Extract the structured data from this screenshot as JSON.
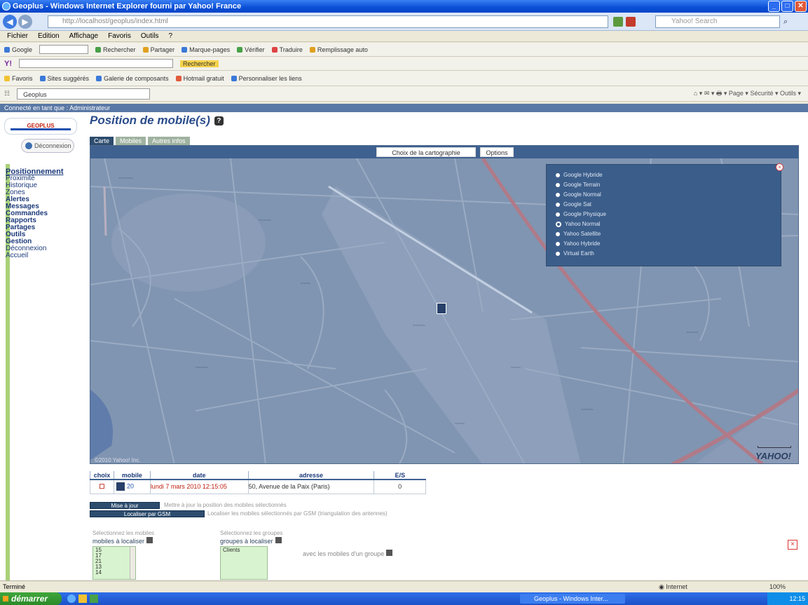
{
  "window": {
    "title": "Geoplus - Windows Internet Explorer fourni par Yahoo! France",
    "url": "http://localhost/geoplus/index.html",
    "search_placeholder": "Yahoo! Search",
    "menu": [
      "Fichier",
      "Edition",
      "Affichage",
      "Favoris",
      "Outils",
      "?"
    ]
  },
  "toolbars": {
    "google": [
      "Google",
      "Rechercher",
      "Partager",
      "Marque-pages",
      "Vérifier",
      "Traduire",
      "Remplissage auto"
    ],
    "links": [
      "Favoris",
      "Sites suggérés",
      "Galerie de composants",
      "Hotmail gratuit",
      "Personnaliser les liens"
    ],
    "tab_label": "Geoplus"
  },
  "page": {
    "user_bar": "Connecté en tant que : Administrateur",
    "logo": "GEOPLUS",
    "logout": "Déconnexion",
    "title": "Position de mobile(s)",
    "tabs": [
      "Carte",
      "Mobiles",
      "Autres infos"
    ],
    "nav": [
      {
        "label": "Positionnement",
        "active": true
      },
      {
        "label": "Proximité",
        "active": false
      },
      {
        "label": "Historique",
        "active": false
      },
      {
        "label": "Zones",
        "active": false
      },
      {
        "label": "Alertes",
        "active": false
      },
      {
        "label": "Messages",
        "active": false
      },
      {
        "label": "Commandes",
        "active": false
      },
      {
        "label": "Rapports",
        "active": false
      },
      {
        "label": "Partages",
        "active": false
      },
      {
        "label": "Outils",
        "active": false
      },
      {
        "label": "Gestion",
        "active": false
      },
      {
        "label": "Déconnexion",
        "active": false
      },
      {
        "label": "Accueil",
        "active": false
      }
    ]
  },
  "map": {
    "toolbar": {
      "cartography": "Choix de la cartographie",
      "options": "Options"
    },
    "layers": [
      {
        "label": "Google Hybride",
        "checked": false
      },
      {
        "label": "Google Terrain",
        "checked": false
      },
      {
        "label": "Google Normal",
        "checked": false
      },
      {
        "label": "Google Sat",
        "checked": false
      },
      {
        "label": "Google Physique",
        "checked": false
      },
      {
        "label": "Yahoo Normal",
        "checked": true
      },
      {
        "label": "Yahoo Satellite",
        "checked": false
      },
      {
        "label": "Yahoo Hybride",
        "checked": false
      },
      {
        "label": "Virtual Earth",
        "checked": false
      }
    ],
    "copyright": "©2010 Yahoo! Inc.",
    "provider": "YAHOO!"
  },
  "results": {
    "headers": [
      "choix",
      "mobile",
      "date",
      "adresse",
      "E/S"
    ],
    "rows": [
      {
        "choice": "☐",
        "mobile": "20",
        "date": "lundi 7 mars 2010 12:15:05",
        "address": "50, Avenue de la Paix (Paris)",
        "es": "0"
      }
    ]
  },
  "actions": {
    "update_label": "Mise à jour",
    "update_note": "Mettre à jour la position des mobiles sélectionnés",
    "locate_label": "Localiser par GSM",
    "locate_note": "Localiser les mobiles sélectionnés par GSM (triangulation des antennes)"
  },
  "selection": {
    "mobiles_hint": "Sélectionnez les mobiles",
    "mobiles_label": "mobiles à localiser",
    "mobiles": [
      "15",
      "17",
      "21",
      "13",
      "14"
    ],
    "groups_hint": "Sélectionnez les groupes",
    "groups_label": "groupes à localiser",
    "groups": [
      "Clients"
    ],
    "with_groups": "avec les mobiles d'un groupe"
  },
  "status": {
    "left": "Terminé",
    "zone": "Internet",
    "zoom": "100%"
  },
  "taskbar": {
    "start": "démarrer",
    "items": [
      "Geoplus - Windows Inter..."
    ],
    "clock": "12:15"
  }
}
